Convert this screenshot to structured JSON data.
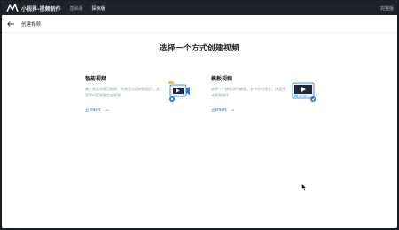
{
  "topbar": {
    "app_title": "小视界-视频制作",
    "tabs": [
      {
        "label": "基础版",
        "active": false
      },
      {
        "label": "探索版",
        "active": true
      }
    ],
    "help_label": "完整版"
  },
  "header": {
    "page_title": "创建视频"
  },
  "main": {
    "title": "选择一个方式创建视频",
    "cards": [
      {
        "title": "智能视频",
        "desc": "输入商品详情页链接，系统会自动抓取图片、文案等内容智能生成视频",
        "link": "立即制作",
        "link_arrow": "→"
      },
      {
        "title": "模板视频",
        "desc": "选择一个模板进行编辑，支持实时预览，快速完成视频制作",
        "link": "立即制作",
        "link_arrow": "→"
      }
    ]
  },
  "icons": {
    "logo": "logo-icon",
    "back": "arrow-left-icon",
    "smart": "video-camera-icon",
    "template": "video-template-icon",
    "cursor": "mouse-cursor-icon"
  },
  "colors": {
    "topbar": "#1f2229",
    "link": "#2f7ae0",
    "accent": "#2f7ae0"
  }
}
